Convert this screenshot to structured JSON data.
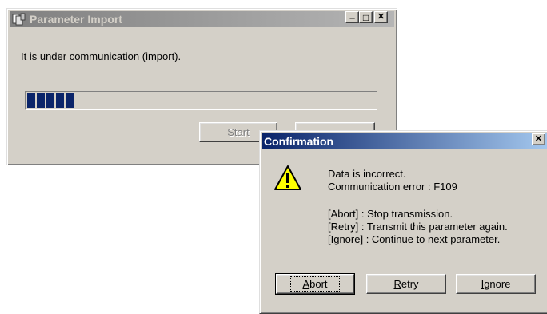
{
  "import_window": {
    "title": "Parameter Import",
    "message": "It is under communication (import).",
    "progress": {
      "percent": 16,
      "blocks": 5,
      "color": "#0a246a"
    },
    "buttons": {
      "start": "Start",
      "cancel": ""
    },
    "caption_buttons": {
      "minimize": "_",
      "maximize": "□",
      "close": "✕"
    }
  },
  "confirm_dialog": {
    "title": "Confirmation",
    "close_glyph": "✕",
    "icon": "warning-icon",
    "line1": "Data is incorrect.",
    "line2": "Communication error : F109",
    "help": [
      "[Abort] : Stop transmission.",
      "[Retry] : Transmit this parameter again.",
      "[Ignore] : Continue to next parameter."
    ],
    "buttons": {
      "abort_access": "A",
      "abort_rest": "bort",
      "retry_access": "R",
      "retry_rest": "etry",
      "ignore_access": "I",
      "ignore_rest": "gnore"
    }
  },
  "colors": {
    "face": "#d4d0c8",
    "active_title_start": "#0a246a",
    "active_title_end": "#a6caf0",
    "inactive_title_start": "#808080",
    "warning": "#ffff00"
  }
}
